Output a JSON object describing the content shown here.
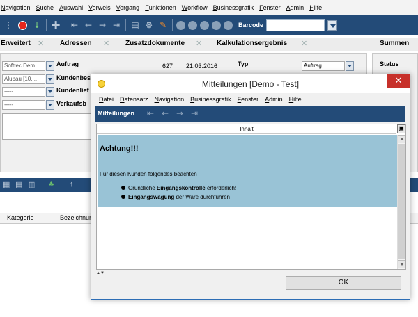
{
  "menubar": {
    "items": [
      "Navigation",
      "Suche",
      "Auswahl",
      "Verweis",
      "Vorgang",
      "Funktionen",
      "Workflow",
      "Businessgrafik",
      "Fenster",
      "Admin",
      "Hilfe"
    ]
  },
  "toolbar": {
    "barcode_label": "Barcode",
    "barcode_value": ""
  },
  "tabs": [
    {
      "label": "Erweitert"
    },
    {
      "label": "Adressen"
    },
    {
      "label": "Zusatzdokumente"
    },
    {
      "label": "Kalkulationsergebnis"
    },
    {
      "label": "Summen"
    }
  ],
  "form": {
    "field_1": "Softtec Dem...",
    "field_2": "Alubau [10....",
    "field_3": "-----",
    "field_4": "-----",
    "label_auftrag": "Auftrag",
    "label_kundenbes": "Kundenbes",
    "label_kundenlief": "Kundenlief",
    "label_verkaufsb": "Verkaufsb",
    "auftrag_number": "627",
    "auftrag_date": "21.03.2016",
    "typ_label": "Typ",
    "typ_value": "Auftrag",
    "status_label": "Status"
  },
  "grid": {
    "columns": [
      "Kategorie",
      "Bezeichnun"
    ]
  },
  "dialog": {
    "title": "Mitteilungen [Demo - Test]",
    "close_glyph": "✕",
    "menu": [
      "Datei",
      "Datensatz",
      "Navigation",
      "Businessgrafik",
      "Fenster",
      "Admin",
      "Hilfe"
    ],
    "toolbar_title": "Mitteilungen",
    "column_header": "Inhalt",
    "message": {
      "heading": "Achtung!!!",
      "intro": "Für diesen Kunden folgendes beachten",
      "bullet_1_pre": "Gründliche ",
      "bullet_1_bold": "Eingangskontrolle",
      "bullet_1_post": " erforderlich!",
      "bullet_2_bold": "Eingangswägung",
      "bullet_2_post": " der Ware durchführen"
    },
    "ok_label": "OK"
  },
  "colors": {
    "toolbar_blue": "#234b78",
    "message_bg": "#99c3d6",
    "record_red": "#e5261d",
    "close_red": "#c7302a"
  },
  "icons": [
    "record-icon",
    "add-icon",
    "first-icon",
    "prev-icon",
    "next-icon",
    "last-icon",
    "edit-icon",
    "app-icon",
    "close-icon"
  ]
}
